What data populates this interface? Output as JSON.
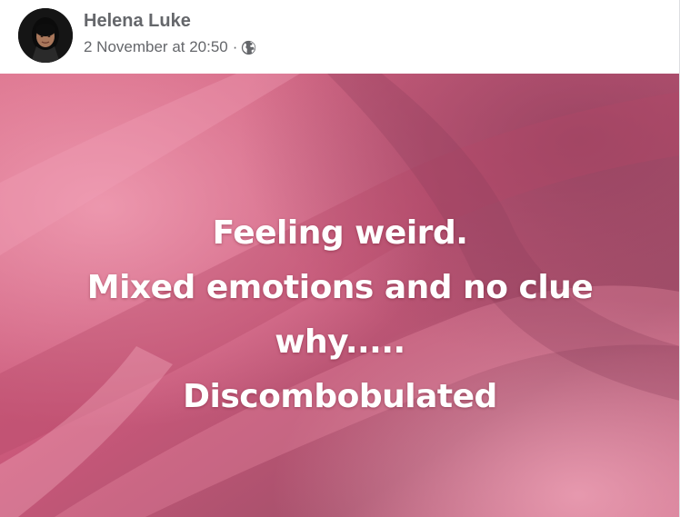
{
  "post": {
    "author": {
      "name": "Helena Luke",
      "avatar_icon": "profile-photo"
    },
    "timestamp": "2 November at 20:50",
    "separator": "·",
    "audience_icon": "globe-icon",
    "status": {
      "lines": [
        "Feeling weird.",
        "Mixed emotions and no clue",
        "why.....",
        "Discombobulated"
      ],
      "text_color": "#ffffff",
      "background_colors": [
        "#d1627f",
        "#c4506e",
        "#9c4763",
        "#e07a98"
      ]
    }
  },
  "colors": {
    "meta_text": "#65676b",
    "card_bg": "#ffffff"
  }
}
